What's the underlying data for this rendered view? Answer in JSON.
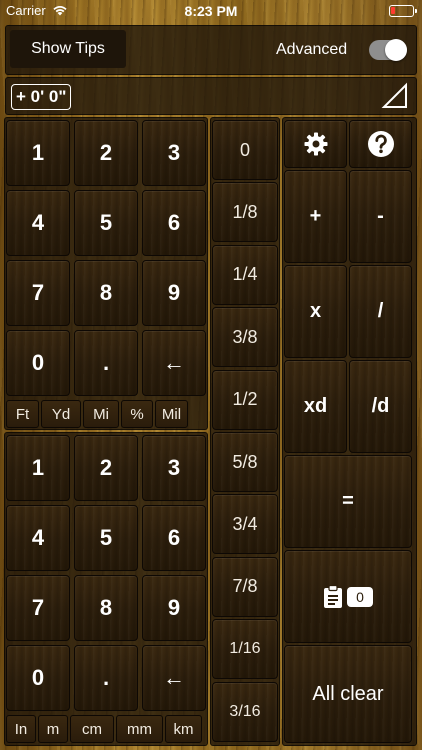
{
  "status": {
    "carrier": "Carrier",
    "time": "8:23 PM"
  },
  "top": {
    "show_tips": "Show Tips",
    "advanced_label": "Advanced",
    "advanced_on": true
  },
  "display": {
    "value": "+ 0' 0\""
  },
  "feet_pad": {
    "keys": [
      "1",
      "2",
      "3",
      "4",
      "5",
      "6",
      "7",
      "8",
      "9",
      "0",
      ".",
      "←"
    ]
  },
  "feet_units": [
    "Ft",
    "Yd",
    "Mi",
    "%",
    "Mil"
  ],
  "inch_pad": {
    "keys": [
      "1",
      "2",
      "3",
      "4",
      "5",
      "6",
      "7",
      "8",
      "9",
      "0",
      ".",
      "←"
    ]
  },
  "inch_units": [
    "In",
    "m",
    "cm",
    "mm",
    "km"
  ],
  "fractions": [
    "0",
    "1/8",
    "1/4",
    "3/8",
    "1/2",
    "5/8",
    "3/4",
    "7/8",
    "1/16",
    "3/16"
  ],
  "ops": {
    "plus": "+",
    "minus": "-",
    "times": "x",
    "divide": "/",
    "xd": "xd",
    "divd": "/d",
    "equals": "=",
    "memory_count": "0",
    "all_clear": "All clear"
  },
  "icons": {
    "settings": "gear-icon",
    "help": "question-icon",
    "clipboard": "clipboard-icon",
    "triangle": "triangle-icon"
  }
}
